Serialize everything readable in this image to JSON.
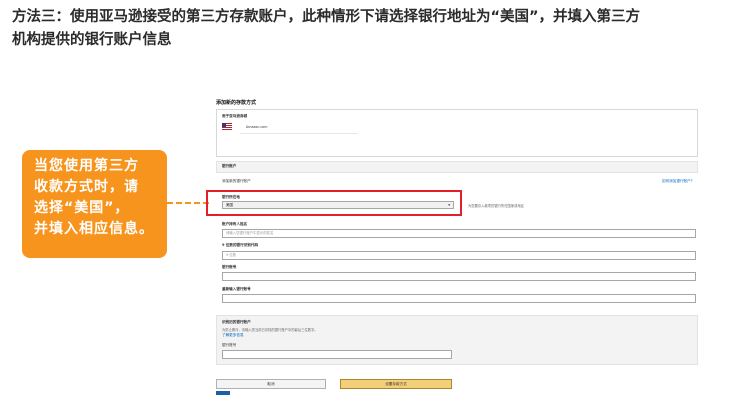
{
  "heading": {
    "line1": "方法三：使用亚马逊接受的第三方存款账户，此种情形下请选择银行地址为“美国”，并填入第三方",
    "line2": "机构提供的银行账户信息"
  },
  "callout": {
    "lines": [
      "当您使用第三方",
      "收款方式时，请",
      "选择“美国”，",
      "并填入相应信息。"
    ]
  },
  "form": {
    "page_title": "添加新的存款方式",
    "seller_label": "用于亚马逊商城",
    "seller_value": "Amazon.com",
    "bank_section_title": "银行账户",
    "bank_section_sub": "添加新的银行账户",
    "help_link": "如何添加银行账户?",
    "bank_location_label": "银行所在地",
    "bank_location_value": "美国",
    "bank_location_note": "为您要存入款项的银行所在国家或地区",
    "holder_label": "账户持有人姓名",
    "holder_placeholder": "请输入您银行账户中显示的姓名",
    "routing_label": "9 位数的银行识别代码",
    "routing_placeholder": "9 位数",
    "account_label": "银行账号",
    "account_confirm_label": "重新输入银行账号",
    "old_section_title": "识别旧的银行账户",
    "old_section_desc": "为防止欺诈，请输入您当前已存档的银行账户中的最后三位数字。",
    "old_section_link": "了解更多信息",
    "old_account_label": "银行账号",
    "cancel_label": "取消",
    "submit_label": "设置存款方式"
  }
}
